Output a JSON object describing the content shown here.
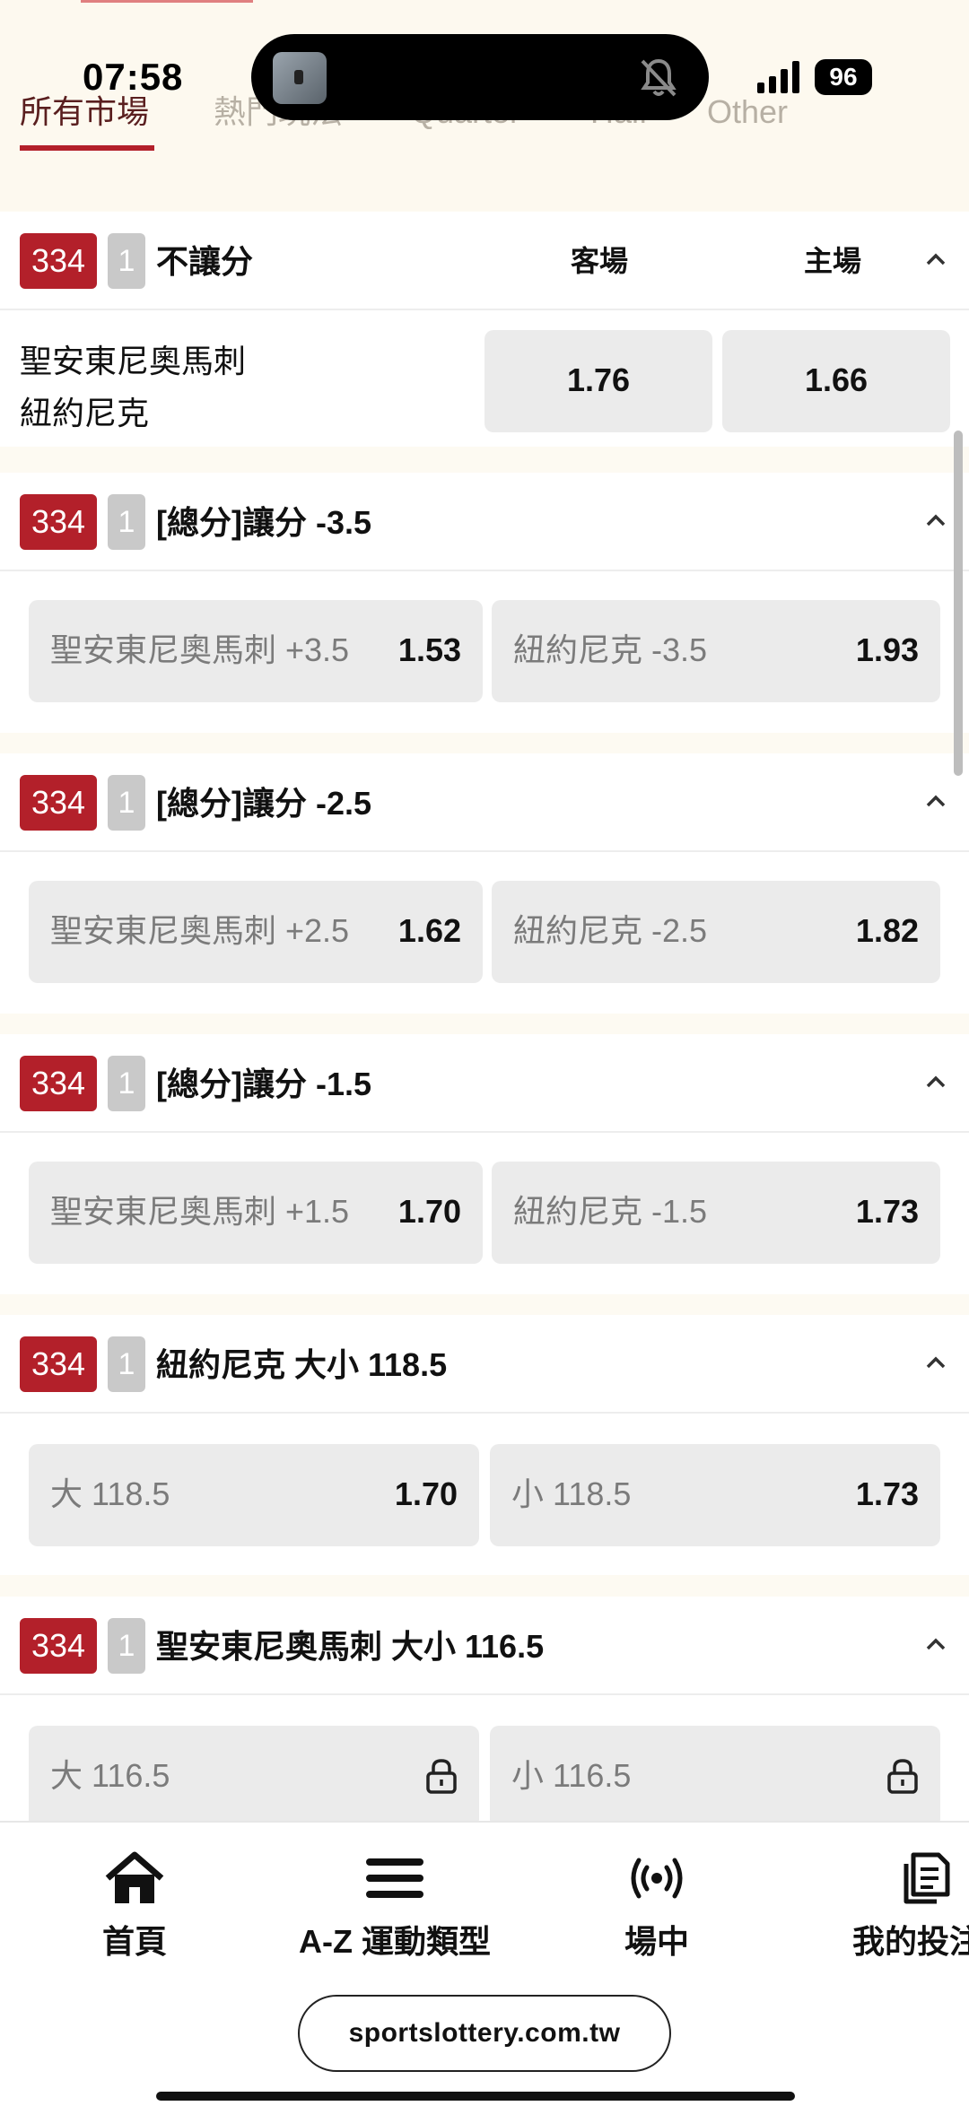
{
  "status_bar": {
    "time": "07:58",
    "battery": "96"
  },
  "tabs": [
    {
      "label": "所有市場",
      "active": true
    },
    {
      "label": "熱門玩法",
      "active": false
    },
    {
      "label": "Quarter",
      "active": false
    },
    {
      "label": "Half",
      "active": false
    },
    {
      "label": "Other",
      "active": false
    }
  ],
  "markets": [
    {
      "badge": "334",
      "sub_badge": "1",
      "title": "不讓分",
      "col_away": "客場",
      "col_home": "主場",
      "team_away": "聖安東尼奧馬刺",
      "team_home": "紐約尼克",
      "odds": [
        "1.76",
        "1.66"
      ]
    },
    {
      "badge": "334",
      "sub_badge": "1",
      "title": "[總分]讓分 -3.5",
      "options": [
        {
          "label": "聖安東尼奧馬刺 +3.5",
          "odd": "1.53"
        },
        {
          "label": "紐約尼克 -3.5",
          "odd": "1.93"
        }
      ]
    },
    {
      "badge": "334",
      "sub_badge": "1",
      "title": "[總分]讓分 -2.5",
      "options": [
        {
          "label": "聖安東尼奧馬刺 +2.5",
          "odd": "1.62"
        },
        {
          "label": "紐約尼克 -2.5",
          "odd": "1.82"
        }
      ]
    },
    {
      "badge": "334",
      "sub_badge": "1",
      "title": "[總分]讓分 -1.5",
      "options": [
        {
          "label": "聖安東尼奧馬刺 +1.5",
          "odd": "1.70"
        },
        {
          "label": "紐約尼克 -1.5",
          "odd": "1.73"
        }
      ]
    },
    {
      "badge": "334",
      "sub_badge": "1",
      "title": "紐約尼克 大小 118.5",
      "options": [
        {
          "label": "大 118.5",
          "odd": "1.70"
        },
        {
          "label": "小 118.5",
          "odd": "1.73"
        }
      ]
    },
    {
      "badge": "334",
      "sub_badge": "1",
      "title": "聖安東尼奧馬刺 大小 116.5",
      "options": [
        {
          "label": "大 116.5",
          "icon": "lock-icon"
        },
        {
          "label": "小 116.5",
          "icon": "lock-icon"
        }
      ]
    }
  ],
  "bottom_nav": [
    {
      "label": "首頁",
      "icon": "home-icon"
    },
    {
      "label": "A-Z 運動類型",
      "icon": "menu-icon"
    },
    {
      "label": "場中",
      "icon": "live-broadcast-icon"
    },
    {
      "label": "我的投注",
      "icon": "bets-copy-icon"
    }
  ],
  "browser": {
    "url": "sportslottery.com.tw"
  },
  "colors": {
    "accent": "#b3202a",
    "badge_grey": "#c9c9c9",
    "odd_bg": "#ebebeb",
    "page_bg": "#fdfaf2"
  }
}
